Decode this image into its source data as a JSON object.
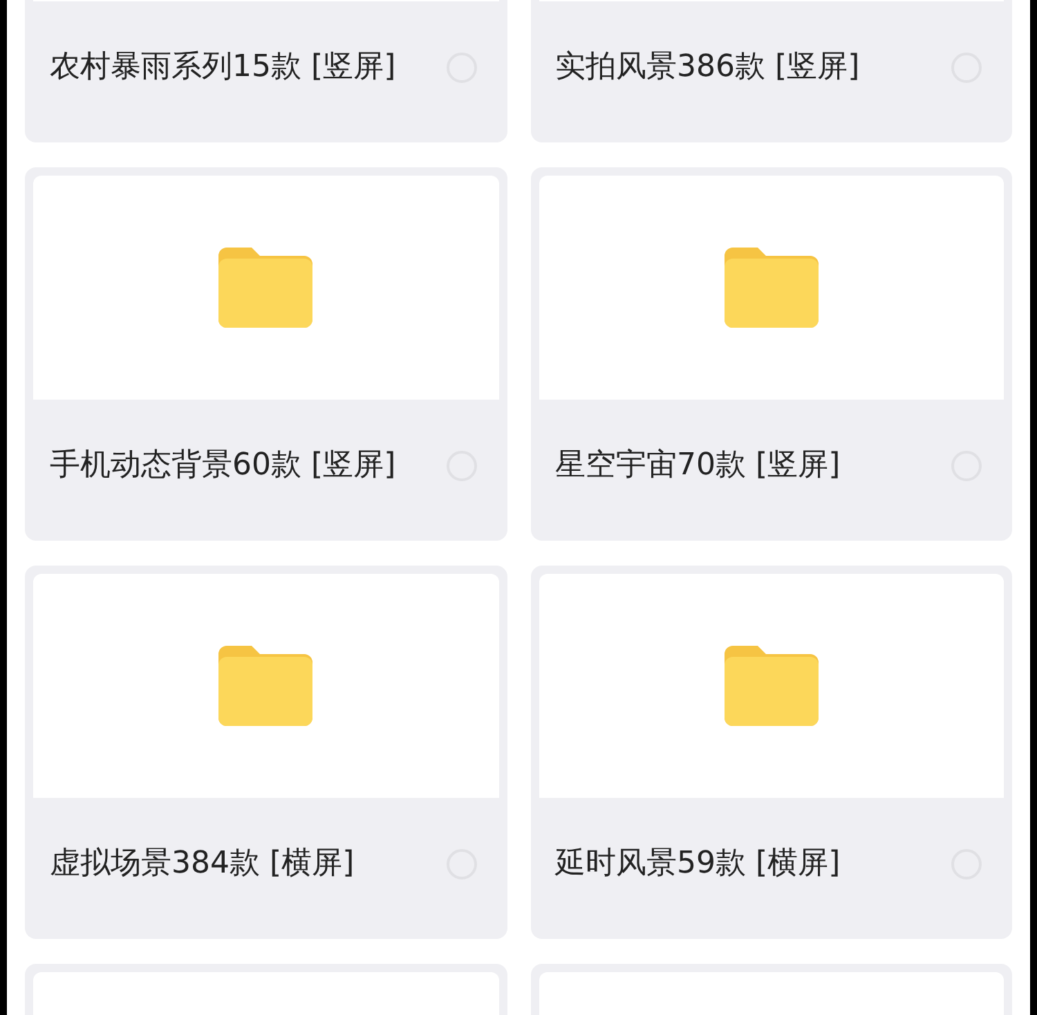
{
  "folders": [
    {
      "kind": "cut",
      "title": "农村暴雨系列15款 [竖屏]",
      "selected": false
    },
    {
      "kind": "cut",
      "title": "实拍风景386款 [竖屏]",
      "selected": false
    },
    {
      "kind": "folder",
      "title": "手机动态背景60款 [竖屏]",
      "selected": false
    },
    {
      "kind": "folder",
      "title": "星空宇宙70款 [竖屏]",
      "selected": false
    },
    {
      "kind": "folder",
      "title": "虚拟场景384款 [横屏]",
      "selected": false
    },
    {
      "kind": "folder",
      "title": "延时风景59款 [横屏]",
      "selected": false
    },
    {
      "kind": "blank"
    },
    {
      "kind": "blank"
    }
  ]
}
